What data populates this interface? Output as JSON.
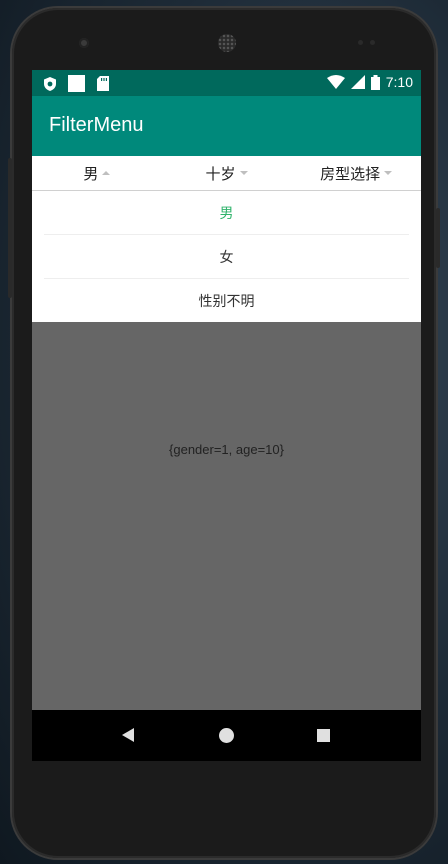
{
  "status_bar": {
    "time": "7:10",
    "icons": [
      "shield-icon",
      "square-icon",
      "sdcard-icon",
      "wifi-icon",
      "signal-icon",
      "battery-icon"
    ]
  },
  "app": {
    "title": "FilterMenu"
  },
  "filter_tabs": [
    {
      "label": "男",
      "arrow": "up"
    },
    {
      "label": "十岁",
      "arrow": "down"
    },
    {
      "label": "房型选择",
      "arrow": "down"
    }
  ],
  "dropdown": {
    "options": [
      "男",
      "女",
      "性别不明"
    ],
    "selected": "男",
    "selected_color": "#2fb36b"
  },
  "result_text": "{gender=1, age=10}",
  "colors": {
    "status_bar": "#00695c",
    "app_bar": "#00897b",
    "overlay": "#666666"
  }
}
